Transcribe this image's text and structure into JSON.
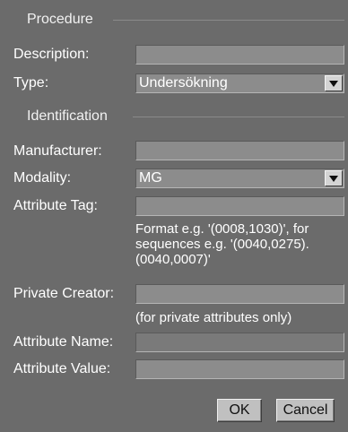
{
  "procedure": {
    "legend": "Procedure",
    "description_label": "Description:",
    "description_value": "",
    "type_label": "Type:",
    "type_value": "Undersökning"
  },
  "identification": {
    "legend": "Identification",
    "manufacturer_label": "Manufacturer:",
    "manufacturer_value": "",
    "modality_label": "Modality:",
    "modality_value": "MG",
    "attribute_tag_label": "Attribute Tag:",
    "attribute_tag_value": "",
    "attribute_tag_hint": "Format e.g. '(0008,1030)', for sequences e.g. '(0040,0275).(0040,0007)'",
    "private_creator_label": "Private Creator:",
    "private_creator_value": "",
    "private_creator_hint": "(for private attributes only)",
    "attribute_name_label": "Attribute Name:",
    "attribute_name_value": "",
    "attribute_value_label": "Attribute Value:",
    "attribute_value_value": ""
  },
  "buttons": {
    "ok": "OK",
    "cancel": "Cancel"
  },
  "icons": {
    "dropdown": "chevron-down-icon"
  }
}
